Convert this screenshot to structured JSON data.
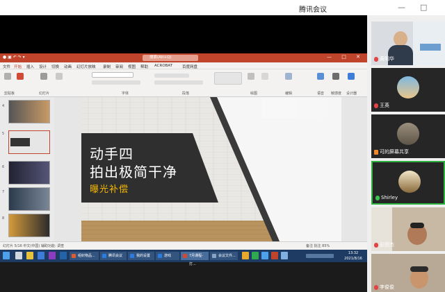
{
  "meeting": {
    "title": "腾讯会议",
    "minimize": "—",
    "maximize": "□"
  },
  "powerpoint": {
    "search_text": "搜索(Alt+Q)",
    "window_controls": "— □ ✕",
    "tabs": [
      "文件",
      "开始",
      "插入",
      "设计",
      "切换",
      "动画",
      "幻灯片放映",
      "录制",
      "审阅",
      "视图",
      "帮助",
      "ACROBAT",
      "百度网盘"
    ],
    "ribbon_groups": [
      "剪贴板",
      "幻灯片",
      "字体",
      "段落",
      "绘图",
      "编辑",
      "语音",
      "敏感度",
      "设计器"
    ],
    "slide_numbers": [
      "4",
      "5",
      "6",
      "7",
      "8"
    ],
    "status_left": "幻灯片 5/16   中文(中国)   辅助功能: 调查",
    "status_right": "备注   批注   85%",
    "zoom": "85%"
  },
  "slide": {
    "line1": "动手四",
    "line2": "拍出极简干净",
    "line3": "曝光补偿",
    "accent_color": "#f5b800"
  },
  "taskbar": {
    "apps": [
      "组织物品...",
      "腾讯会议",
      "我的设置",
      "游戏",
      "7月课程-打...",
      "会议文件..."
    ],
    "time": "13:32",
    "date": "2021/8/16"
  },
  "participants": [
    {
      "name": "黄明华",
      "mic": "muted"
    },
    {
      "name": "王英",
      "mic": "muted"
    },
    {
      "name": "可的屏幕共享",
      "mic": "sharing"
    },
    {
      "name": "Shirley",
      "mic": "active"
    },
    {
      "name": "彭图杰",
      "mic": "muted"
    },
    {
      "name": "李俊俊",
      "mic": "muted"
    }
  ]
}
